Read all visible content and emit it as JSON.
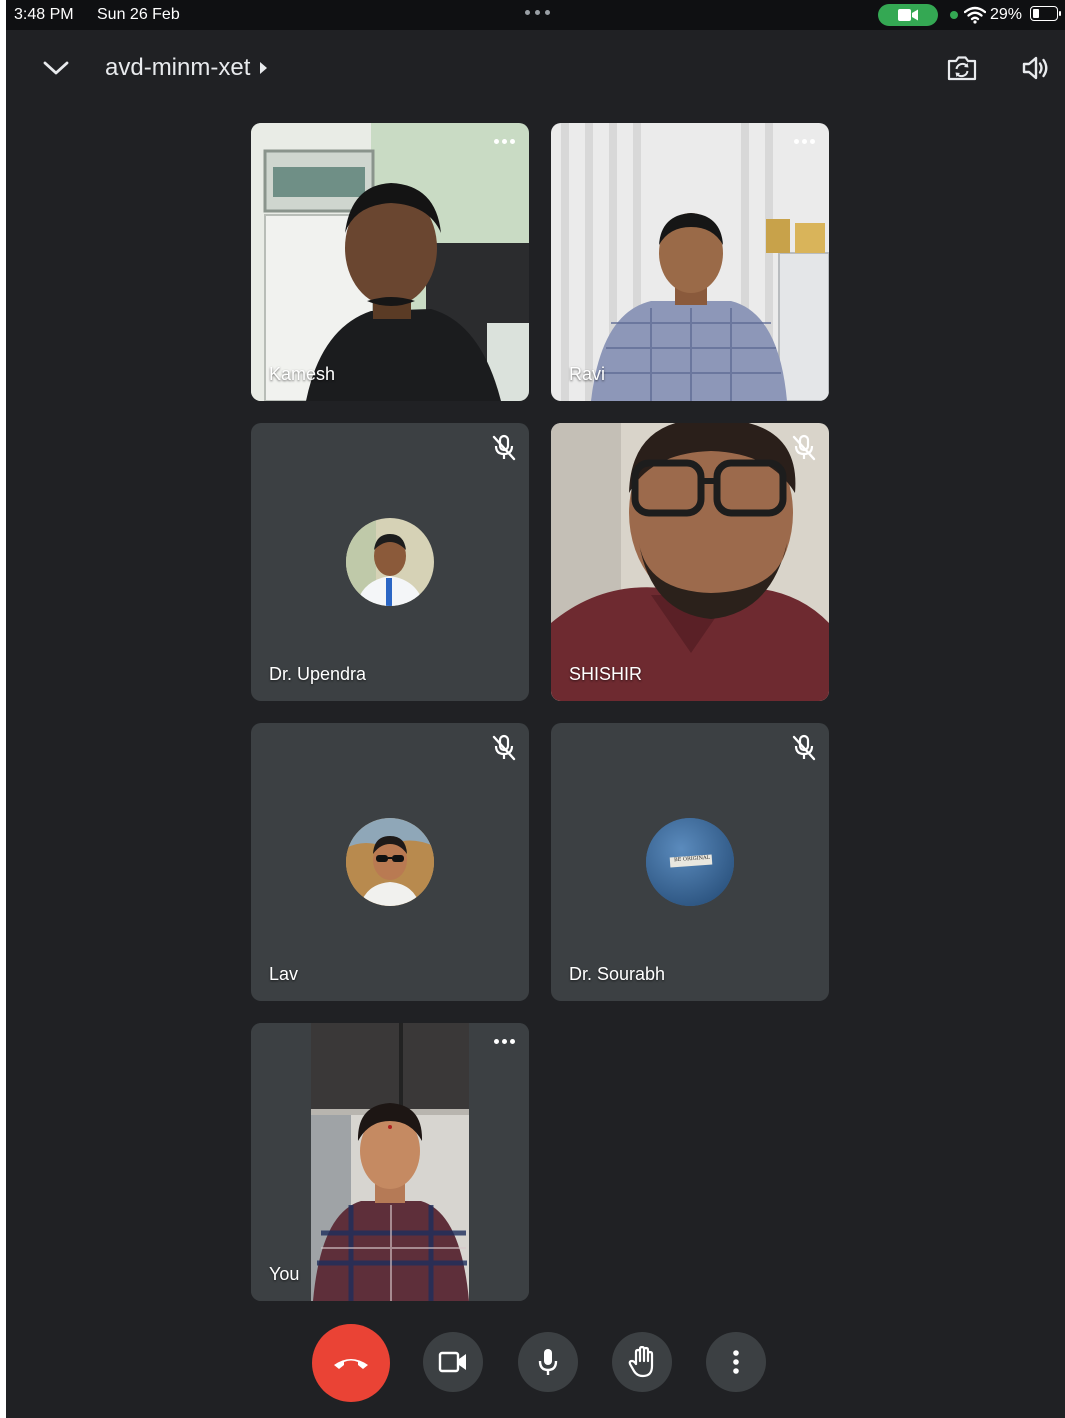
{
  "status_bar": {
    "time": "3:48 PM",
    "date": "Sun 26 Feb",
    "battery": "29%",
    "battery_level": 0.29,
    "camera_indicator_color": "#34a853"
  },
  "header": {
    "meeting_code": "avd-minm-xet",
    "collapse_icon": "chevron-down-icon",
    "switch_camera_icon": "switch-camera-icon",
    "audio_icon": "speaker-icon"
  },
  "participants": [
    {
      "name": "Kamesh",
      "type": "video",
      "muted": false,
      "menu": true
    },
    {
      "name": "Ravi",
      "type": "video",
      "muted": false,
      "menu": true
    },
    {
      "name": "Dr. Upendra",
      "type": "avatar",
      "muted": true
    },
    {
      "name": "SHISHIR",
      "type": "video",
      "muted": true
    },
    {
      "name": "Lav",
      "type": "avatar",
      "muted": true
    },
    {
      "name": "Dr. Sourabh",
      "type": "avatar",
      "muted": true,
      "avatar_text": "BE ORIGINAL"
    },
    {
      "name": "You",
      "type": "video",
      "muted": false,
      "menu": true
    }
  ],
  "controls": {
    "end_call_color": "#ea4335",
    "buttons": [
      "end-call",
      "camera",
      "microphone",
      "raise-hand",
      "more-options"
    ]
  },
  "colors": {
    "background": "#202124",
    "tile": "#3c4043",
    "text": "#ffffff"
  }
}
